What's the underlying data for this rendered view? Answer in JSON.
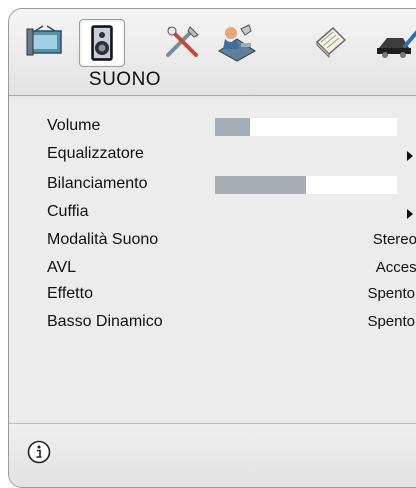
{
  "menu": {
    "title": "SUONO",
    "icons": [
      {
        "name": "picture-icon",
        "selected": false
      },
      {
        "name": "sound-speaker-icon",
        "selected": true
      },
      {
        "name": "settings-tools-icon",
        "selected": false
      },
      {
        "name": "installation-icon",
        "selected": false
      },
      {
        "name": "guide-book-icon",
        "selected": false
      },
      {
        "name": "source-icon",
        "selected": false
      }
    ]
  },
  "settings": {
    "volume": {
      "label": "Volume",
      "value": "10",
      "level": 0.19
    },
    "equalizer": {
      "label": "Equalizzatore"
    },
    "balance": {
      "label": "Bilanciamento",
      "value": "0",
      "level": 0.5
    },
    "headphone": {
      "label": "Cuffia"
    },
    "sound_mode": {
      "label": "Modalità Suono",
      "value": "Stereo"
    },
    "avl": {
      "label": "AVL",
      "value": "Acceso"
    },
    "effect": {
      "label": "Effetto",
      "value": "Spento"
    },
    "bass": {
      "label": "Basso Dinamico",
      "value": "Spento"
    }
  },
  "colors": {
    "bar_fill": "#a8adb4",
    "bar_track": "#ffffff",
    "panel": "#ececec"
  }
}
